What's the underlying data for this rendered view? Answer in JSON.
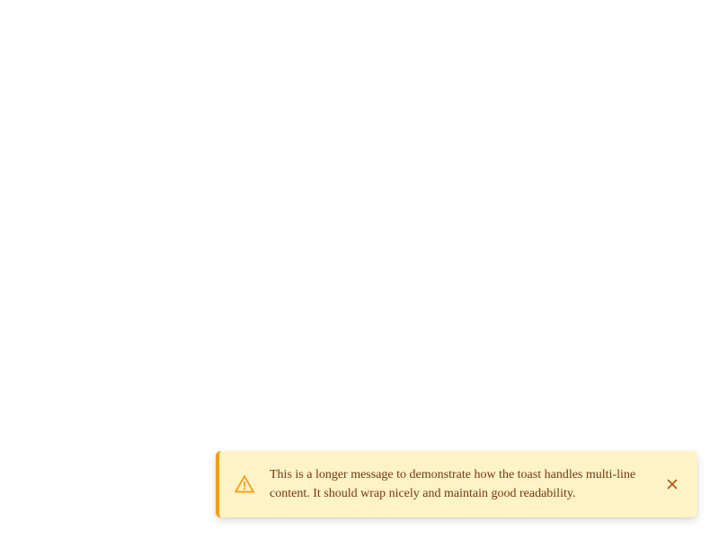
{
  "toast": {
    "type": "warning",
    "icon": "warning-triangle-icon",
    "message": "This is a longer message to demonstrate how the toast handles multi-line content. It should wrap nicely and maintain good readability.",
    "close_icon": "close-icon",
    "colors": {
      "background": "#fef3c7",
      "accent": "#f59e0b",
      "text": "#78350f",
      "close": "#b45309"
    }
  }
}
